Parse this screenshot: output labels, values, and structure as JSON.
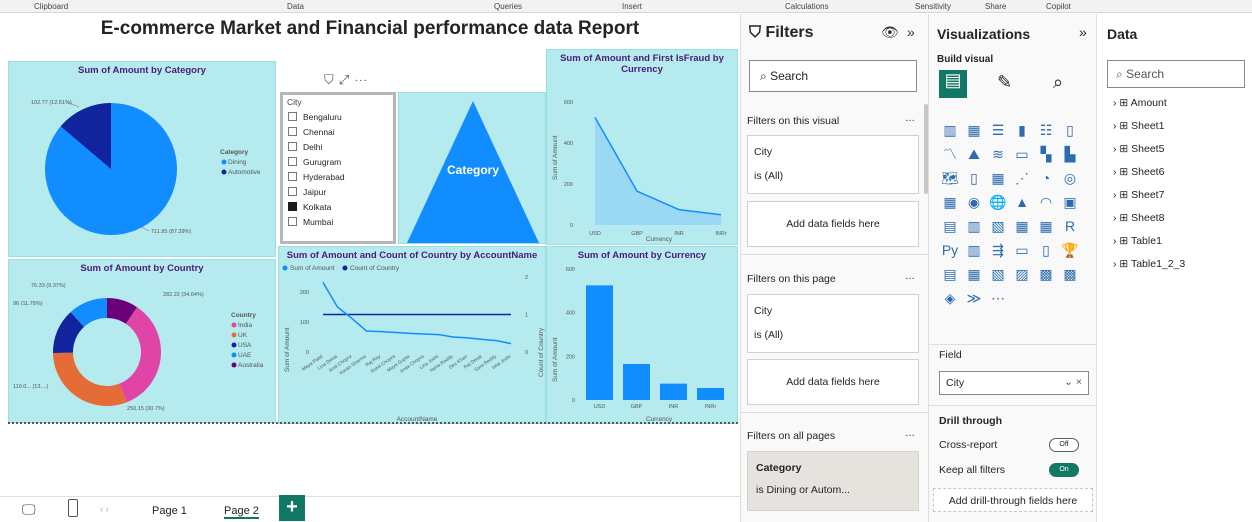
{
  "ribbon": {
    "groups": [
      "Clipboard",
      "Data",
      "Queries",
      "Insert",
      "Calculations",
      "Sensitivity",
      "Share",
      "Copilot"
    ]
  },
  "report": {
    "title": "E-commerce Market and Financial performance data Report"
  },
  "category_chart": {
    "title": "Sum of Amount by Category",
    "legend_title": "Category",
    "legend": [
      "Dining",
      "Automotive"
    ],
    "colors": [
      "#118dff",
      "#12239e"
    ],
    "labels": [
      "102.77 (12.61%)",
      "711.95 (87.39%)"
    ]
  },
  "country_chart": {
    "title": "Sum of Amount by Country",
    "legend_title": "Country",
    "legend": [
      "India",
      "UK",
      "USA",
      "UAE",
      "Australia"
    ],
    "colors": [
      "#e044a7",
      "#e66c37",
      "#12239e",
      "#118dff",
      "#6b007b"
    ],
    "labels": [
      "282.22 (34.64%)",
      "250.15 (30.7%)",
      "110.0... (13....)",
      "96 (11.78%)",
      "76.33 (9.37%)"
    ]
  },
  "slicer": {
    "header": "City",
    "items": [
      {
        "label": "Bengaluru",
        "checked": false
      },
      {
        "label": "Chennai",
        "checked": false
      },
      {
        "label": "Delhi",
        "checked": false
      },
      {
        "label": "Gurugram",
        "checked": false
      },
      {
        "label": "Hyderabad",
        "checked": false
      },
      {
        "label": "Jaipur",
        "checked": false
      },
      {
        "label": "Kolkata",
        "checked": true
      },
      {
        "label": "Mumbai",
        "checked": false
      }
    ]
  },
  "funnel": {
    "label": "Category"
  },
  "fraud_chart": {
    "title": "Sum of Amount and First IsFraud by Currency",
    "ylabel": "Sum of Amount",
    "xlabel": "Currency",
    "yticks": [
      "0",
      "200",
      "400",
      "600"
    ]
  },
  "combo_chart": {
    "title": "Sum of Amount and Count of Country by AccountName",
    "legend": [
      "Sum of Amount",
      "Count of Country"
    ],
    "ylabel": "Sum of Amount",
    "y2label": "Count of Country",
    "xlabel": "AccountName",
    "yticks": [
      "0",
      "100",
      "200"
    ],
    "y2ticks": [
      "0",
      "1",
      "2"
    ]
  },
  "currency_chart": {
    "title": "Sum of Amount by Currency",
    "ylabel": "Sum of Amount",
    "xlabel": "Currency",
    "yticks": [
      "0",
      "200",
      "400",
      "600"
    ]
  },
  "chart_data": [
    {
      "type": "pie",
      "title": "Sum of Amount by Category",
      "categories": [
        "Dining",
        "Automotive"
      ],
      "values": [
        711.95,
        102.77
      ]
    },
    {
      "type": "pie",
      "title": "Sum of Amount by Country",
      "categories": [
        "India",
        "UK",
        "USA",
        "UAE",
        "Australia"
      ],
      "values": [
        282.22,
        250.15,
        110.0,
        96,
        76.33
      ]
    },
    {
      "type": "area",
      "title": "Sum of Amount and First IsFraud by Currency",
      "categories": [
        "USD",
        "GBP",
        "INR",
        "INRr"
      ],
      "values": [
        525,
        165,
        75,
        50
      ],
      "ylabel": "Sum of Amount",
      "xlabel": "Currency",
      "ylim": [
        0,
        600
      ]
    },
    {
      "type": "line",
      "title": "Sum of Amount and Count of Country by AccountName",
      "categories": [
        "Maya Patel",
        "Lina Desai",
        "Amit Chopra",
        "Karan Sharma",
        "Raj Roy",
        "Rohit Chopra",
        "Maya Gupta",
        "Anita Chopra",
        "Lina Joshi",
        "Neha Reddy",
        "Dev Khan",
        "Raj Desai",
        "Sara Reddy",
        "Isha Joshi"
      ],
      "series": [
        {
          "name": "Sum of Amount",
          "values": [
            232,
            150,
            112,
            70,
            68,
            65,
            62,
            60,
            58,
            50,
            47,
            42,
            38,
            28
          ]
        },
        {
          "name": "Count of Country",
          "values": [
            1,
            1,
            1,
            1,
            1,
            1,
            1,
            1,
            1,
            1,
            1,
            1,
            1,
            1
          ]
        }
      ],
      "ylabel": "Sum of Amount",
      "xlabel": "AccountName"
    },
    {
      "type": "bar",
      "title": "Sum of Amount by Currency",
      "categories": [
        "USD",
        "GBP",
        "INR",
        "INRr"
      ],
      "values": [
        525,
        165,
        75,
        55
      ],
      "ylabel": "Sum of Amount",
      "xlabel": "Currency",
      "ylim": [
        0,
        600
      ]
    }
  ],
  "pages": {
    "tabs": [
      "Page 1",
      "Page 2"
    ],
    "add": "+"
  },
  "filters": {
    "title": "Filters",
    "search": "Search",
    "visual_section": "Filters on this visual",
    "page_section": "Filters on this page",
    "all_section": "Filters on all pages",
    "field": "City",
    "field_value": "is (All)",
    "add_fields": "Add data fields here",
    "cat_field": "Category",
    "cat_value": "is Dining or Autom..."
  },
  "visualizations": {
    "title": "Visualizations",
    "build": "Build visual",
    "field_label": "Field",
    "field_value": "City",
    "drill": "Drill through",
    "cross": "Cross-report",
    "cross_state": "Off",
    "keep": "Keep all filters",
    "keep_state": "On",
    "add_drill": "Add drill-through fields here"
  },
  "data_pane": {
    "title": "Data",
    "search": "Search",
    "tables": [
      "Amount",
      "Sheet1",
      "Sheet5",
      "Sheet6",
      "Sheet7",
      "Sheet8",
      "Table1",
      "Table1_2_3"
    ]
  }
}
